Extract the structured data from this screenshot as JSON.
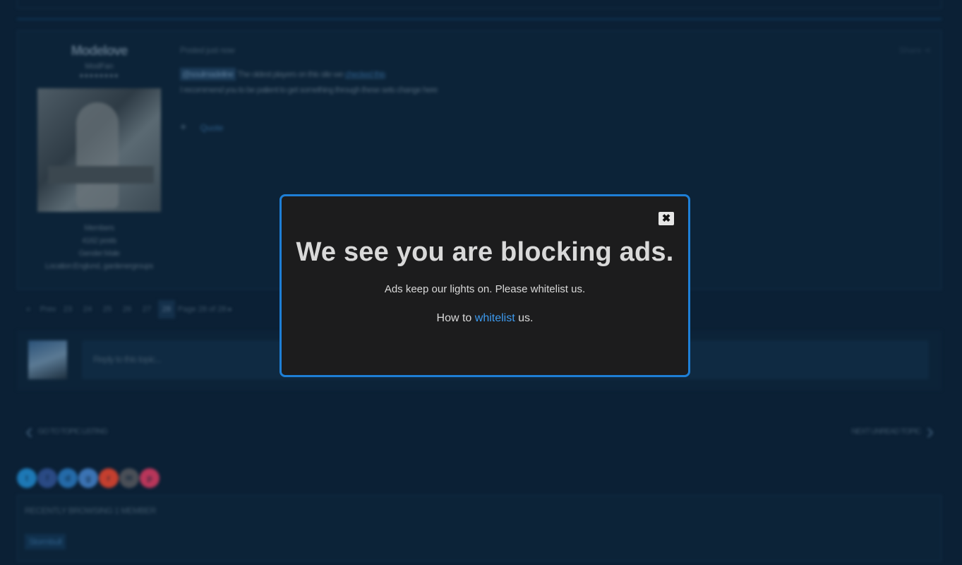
{
  "page": {
    "post": {
      "author_name": "Modelove",
      "author_title": "ModFan",
      "author_stars": "●●●●●●●●",
      "author_meta": [
        "Members",
        "4162 posts",
        "Gender:Male",
        "Location:Englund, gardenergroups"
      ],
      "date": "Posted just now",
      "share_label": "Share",
      "mention": "@soulmadeline",
      "line1_text": " The oldest players on this site we ",
      "line1_link": "checked this",
      "line2_text": "I recommend you to be patient to get something through these sets change here",
      "plus_label": "+",
      "quote_label": "Quote"
    },
    "pager": {
      "items": [
        "«",
        "Prev",
        "23",
        "24",
        "25",
        "26",
        "27",
        "28",
        "Page 28 of 28 ▸"
      ],
      "current": "28"
    },
    "reply": {
      "placeholder": "Reply to this topic..."
    },
    "nav": {
      "prev": "GO TO TOPIC LISTING",
      "next": "NEXT UNREAD TOPIC"
    },
    "social_colors": [
      "#1d78b5",
      "#2a4a84",
      "#246aa8",
      "#3b73b3",
      "#c43f2f",
      "#4a4f57",
      "#b8365a"
    ],
    "social_icons": [
      "twitter-icon",
      "facebook-icon",
      "delicious-icon",
      "digg-icon",
      "reddit-icon",
      "email-icon",
      "pinterest-icon"
    ],
    "lower": {
      "title": "RECENTLY BROWSING  1 MEMBER",
      "tag": "Stormbull"
    }
  },
  "modal": {
    "close_glyph": "✖",
    "heading": "We see you are blocking ads.",
    "subtext": "Ads keep our lights on. Please whitelist us.",
    "how_prefix": "How to ",
    "how_link": "whitelist",
    "how_suffix": " us."
  }
}
